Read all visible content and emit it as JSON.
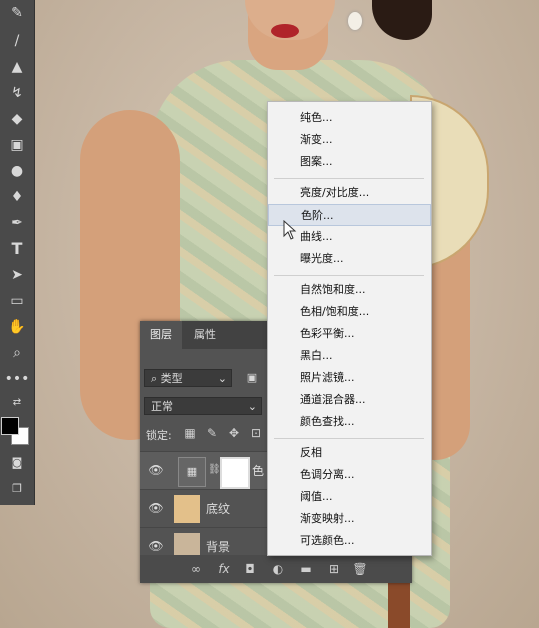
{
  "layers_panel": {
    "tabs": [
      "图层",
      "属性"
    ],
    "filter_kind": "类型",
    "blend_mode": "正常",
    "lock_label": "锁定:",
    "layers": [
      {
        "name": "色",
        "kind": "adjustment"
      },
      {
        "name": "底纹",
        "kind": "image"
      },
      {
        "name": "背景",
        "kind": "image"
      }
    ],
    "bottom_icons": [
      "link-icon",
      "fx-icon",
      "mask-icon",
      "adjustment-icon",
      "folder-icon",
      "new-layer-icon",
      "trash-icon"
    ],
    "fx_label": "fx"
  },
  "adjustment_menu": {
    "groups": [
      [
        "纯色...",
        "渐变...",
        "图案..."
      ],
      [
        "亮度/对比度...",
        "色阶...",
        "曲线...",
        "曝光度..."
      ],
      [
        "自然饱和度...",
        "色相/饱和度...",
        "色彩平衡...",
        "黑白...",
        "照片滤镜...",
        "通道混合器...",
        "颜色查找..."
      ],
      [
        "反相",
        "色调分离...",
        "阈值...",
        "渐变映射...",
        "可选颜色..."
      ]
    ],
    "highlighted": "色阶..."
  },
  "toolbar": {
    "tools": [
      "brush-tool-icon",
      "brush-icon",
      "stamp-icon",
      "history-brush-icon",
      "eraser-icon",
      "gradient-icon",
      "blur-icon",
      "dodge-icon",
      "pen-icon",
      "type-icon",
      "path-select-icon",
      "rectangle-icon",
      "hand-icon",
      "zoom-icon",
      "more-icon"
    ],
    "type_glyph": "T",
    "foreground_color": "#000000",
    "background_color": "#ffffff"
  }
}
